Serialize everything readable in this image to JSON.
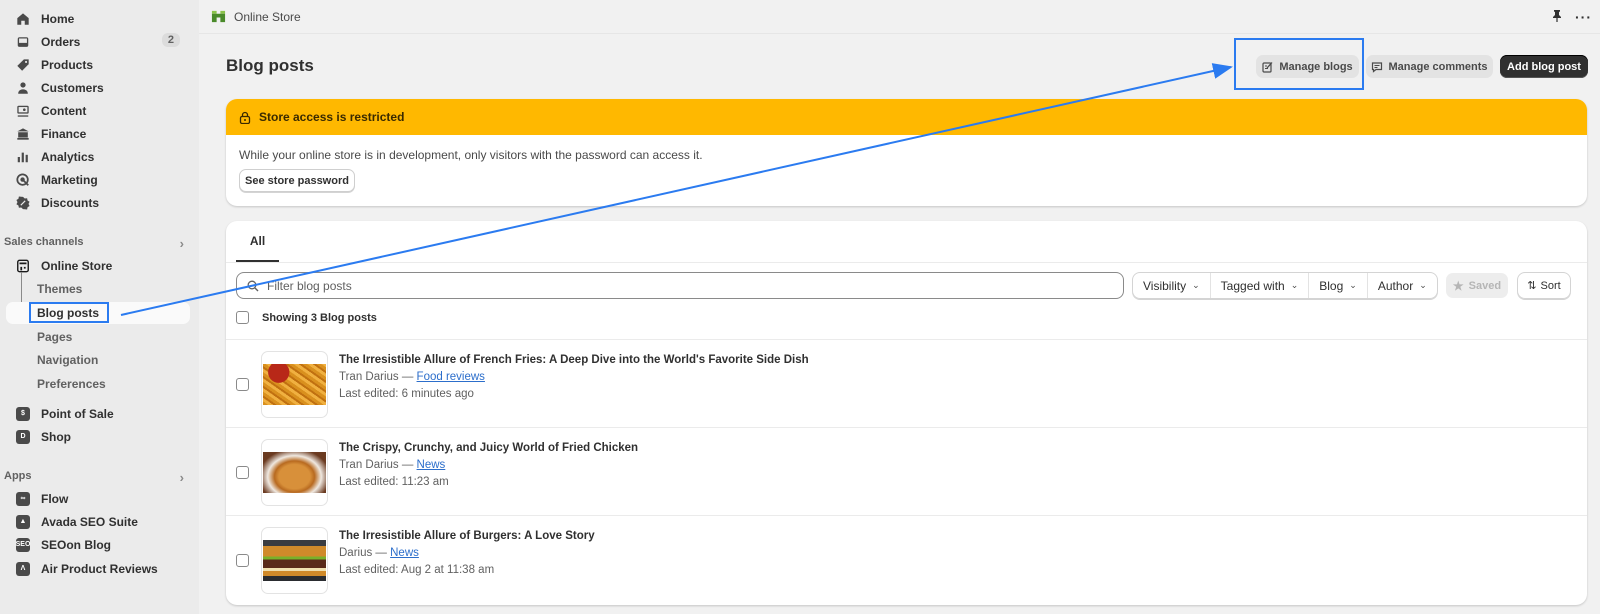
{
  "sidebar": {
    "main_items": [
      {
        "label": "Home",
        "icon": "home-icon"
      },
      {
        "label": "Orders",
        "icon": "inbox-icon",
        "badge": "2"
      },
      {
        "label": "Products",
        "icon": "tag-icon"
      },
      {
        "label": "Customers",
        "icon": "person-icon"
      },
      {
        "label": "Content",
        "icon": "content-icon"
      },
      {
        "label": "Finance",
        "icon": "bank-icon"
      },
      {
        "label": "Analytics",
        "icon": "bar-chart-icon"
      },
      {
        "label": "Marketing",
        "icon": "target-icon"
      },
      {
        "label": "Discounts",
        "icon": "discount-icon"
      }
    ],
    "sales_channels_heading": "Sales channels",
    "online_store": {
      "label": "Online Store",
      "icon": "store-icon"
    },
    "online_store_sub": [
      {
        "label": "Themes"
      },
      {
        "label": "Blog posts",
        "active": true
      },
      {
        "label": "Pages"
      },
      {
        "label": "Navigation"
      },
      {
        "label": "Preferences"
      }
    ],
    "channel_items": [
      {
        "label": "Point of Sale",
        "icon": "pos-icon"
      },
      {
        "label": "Shop",
        "icon": "shop-icon"
      }
    ],
    "apps_heading": "Apps",
    "apps": [
      {
        "label": "Flow",
        "icon": "flow-icon"
      },
      {
        "label": "Avada SEO Suite",
        "icon": "avada-icon"
      },
      {
        "label": "SEOon Blog",
        "icon": "seoon-icon",
        "glyph": "SEO"
      },
      {
        "label": "Air Product Reviews",
        "icon": "air-reviews-icon"
      }
    ]
  },
  "topbar": {
    "title": "Online Store"
  },
  "page": {
    "title": "Blog posts",
    "actions": {
      "manage_blogs": "Manage blogs",
      "manage_comments": "Manage comments",
      "add_blog_post": "Add blog post"
    }
  },
  "banner": {
    "title": "Store access is restricted",
    "text": "While your online store is in development, only visitors with the password can access it.",
    "button": "See store password",
    "color": "#ffb800"
  },
  "list": {
    "tabs": [
      {
        "label": "All",
        "active": true
      }
    ],
    "search_placeholder": "Filter blog posts",
    "filters": [
      "Visibility",
      "Tagged with",
      "Blog",
      "Author"
    ],
    "saved_label": "Saved",
    "sort_label": "Sort",
    "showing": "Showing 3 Blog posts",
    "posts": [
      {
        "title": "The Irresistible Allure of French Fries: A Deep Dive into the World's Favorite Side Dish",
        "author": "Tran Darius",
        "blog": "Food reviews",
        "edited": "Last edited: 6 minutes ago",
        "image": "french-fries"
      },
      {
        "title": "The Crispy, Crunchy, and Juicy World of Fried Chicken",
        "author": "Tran Darius",
        "blog": "News",
        "edited": "Last edited: 11:23 am",
        "image": "fried-chicken"
      },
      {
        "title": "The Irresistible Allure of Burgers: A Love Story",
        "author": "Darius",
        "blog": "News",
        "edited": "Last edited: Aug 2 at 11:38 am",
        "image": "burger"
      }
    ]
  },
  "annotation": {
    "color": "#2b7bf0",
    "from": "Blog posts",
    "to": "Manage blogs"
  }
}
